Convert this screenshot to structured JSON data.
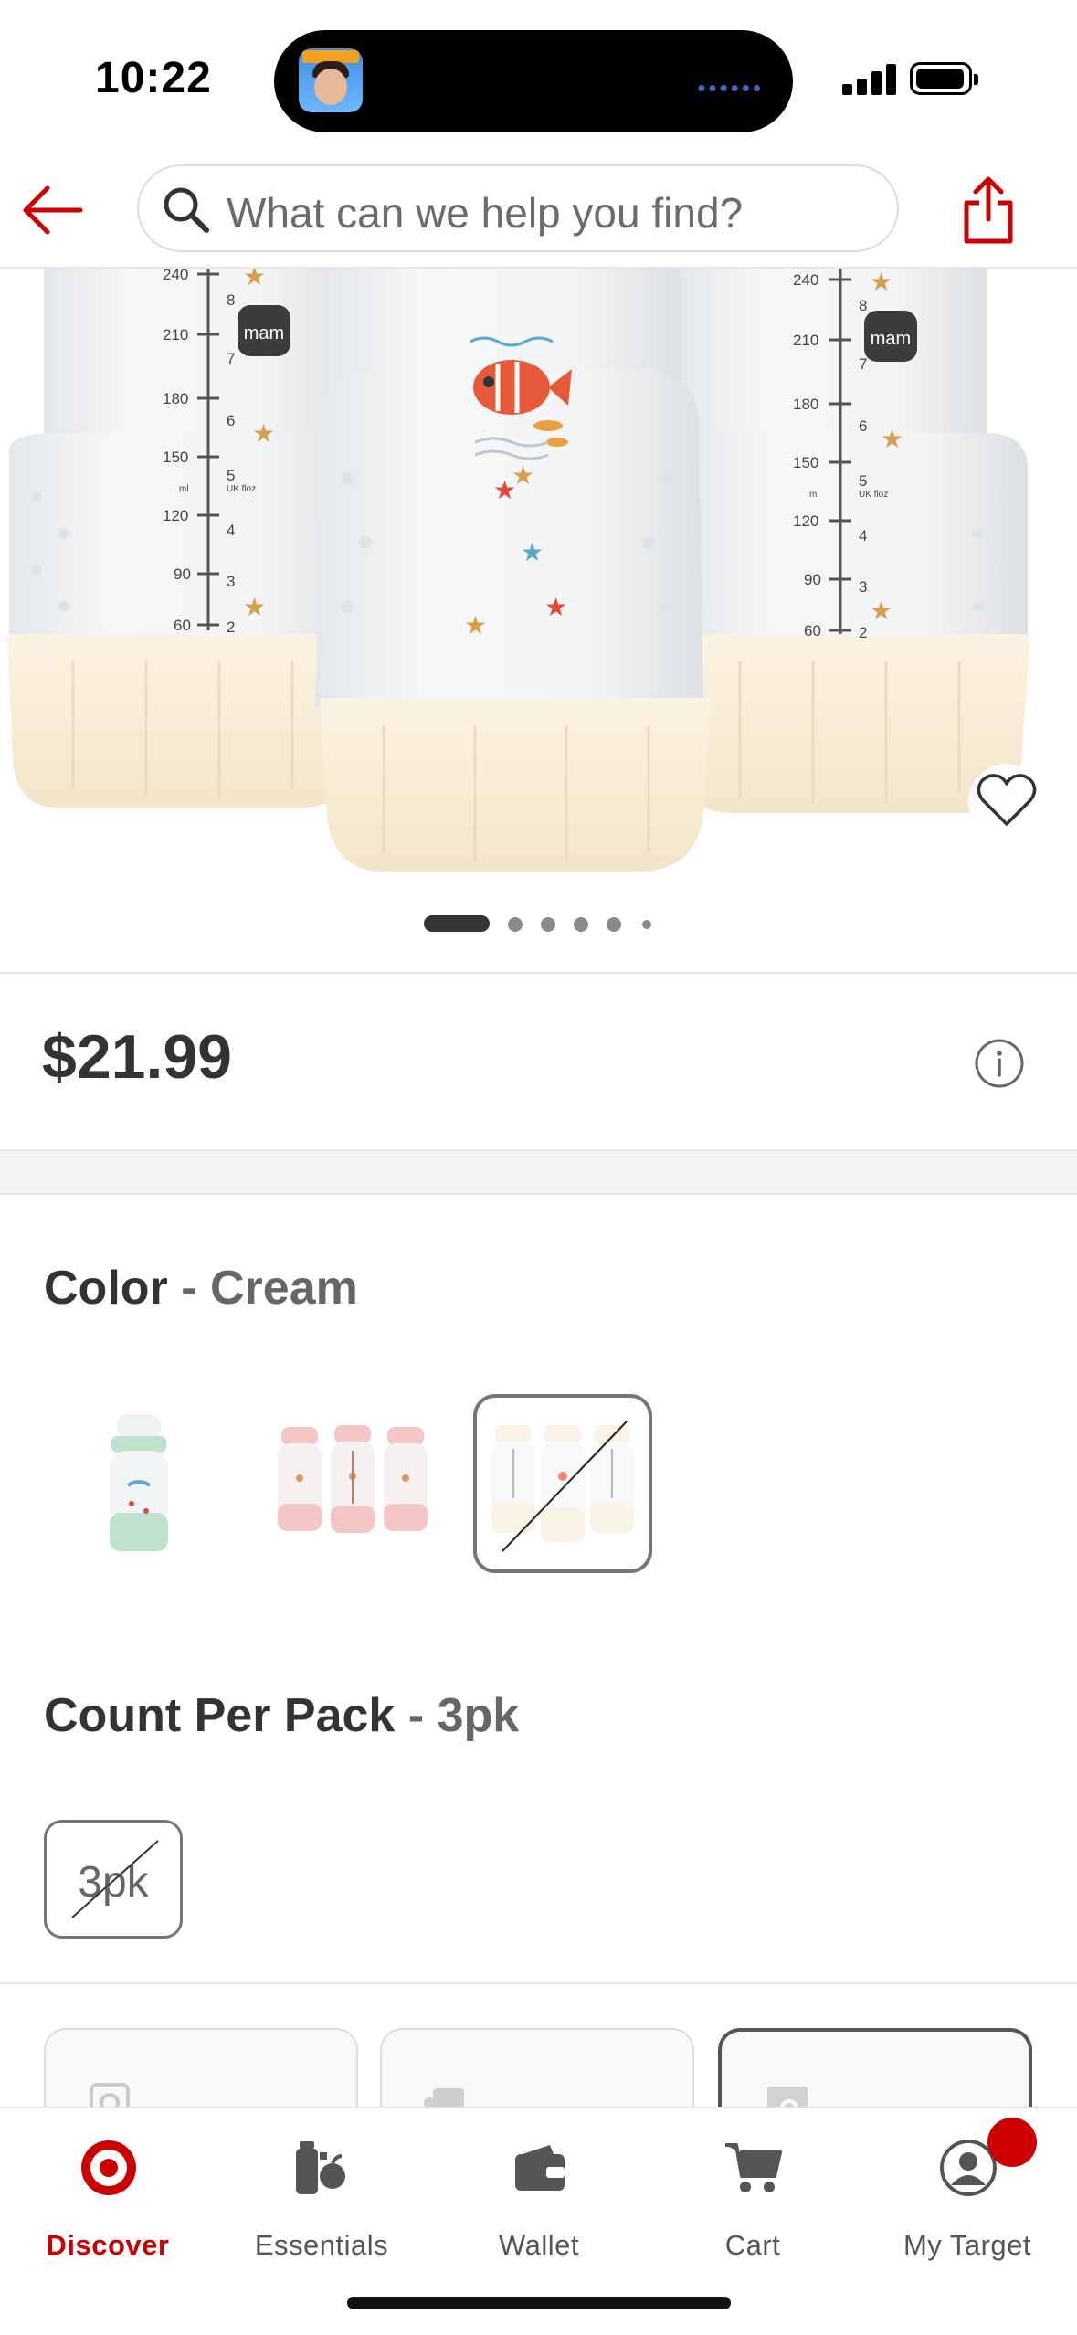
{
  "status_bar": {
    "time": "10:22"
  },
  "search": {
    "placeholder": "What can we help you find?"
  },
  "product": {
    "price": "$21.99",
    "image_alt": "mam",
    "bottle_marks_ml": [
      "240",
      "210",
      "180",
      "150",
      "120",
      "90",
      "60"
    ],
    "bottle_marks_oz": [
      "8",
      "7",
      "6",
      "5",
      "4",
      "3",
      "2"
    ],
    "bottle_units": [
      "ml",
      "UK floz"
    ],
    "carousel": {
      "total_dots": 6,
      "active_index": 0
    }
  },
  "color": {
    "label": "Color",
    "separator": " - ",
    "selected": "Cream",
    "swatches": [
      {
        "name": "Green single",
        "tint": "#cfe9dc"
      },
      {
        "name": "Pink 3-pack",
        "tint": "#f7d6d6"
      },
      {
        "name": "Cream 3-pack",
        "tint": "#f7eedb",
        "selected": true,
        "unavailable": true
      }
    ]
  },
  "count": {
    "label": "Count Per Pack",
    "separator": " - ",
    "selected": "3pk",
    "options": [
      "3pk"
    ]
  },
  "tabbar": {
    "tabs": [
      {
        "label": "Discover",
        "icon": "target-logo-icon",
        "active": true
      },
      {
        "label": "Essentials",
        "icon": "essentials-icon"
      },
      {
        "label": "Wallet",
        "icon": "wallet-icon"
      },
      {
        "label": "Cart",
        "icon": "cart-icon"
      },
      {
        "label": "My Target",
        "icon": "profile-icon"
      }
    ]
  },
  "colors": {
    "brand_red": "#cc0000",
    "text_dark": "#333333",
    "text_muted": "#666666",
    "bottle_base": "#f7ecd6"
  }
}
